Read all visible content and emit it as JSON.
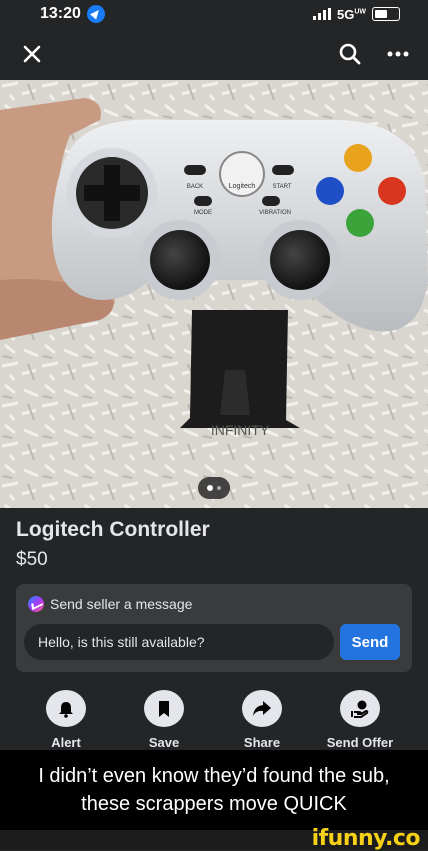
{
  "status_bar": {
    "time": "13:20",
    "network": "5G",
    "network_sup": "UW"
  },
  "nav": {
    "close_icon": "close-icon",
    "search_icon": "search-icon",
    "more_icon": "more-icon"
  },
  "listing": {
    "title": "Logitech Controller",
    "price": "$50",
    "photo_texts": {
      "back": "BACK",
      "start": "START",
      "mode": "MODE",
      "vibration": "VIBRATION",
      "brand": "Logitech",
      "mount": "INFINITY"
    }
  },
  "message": {
    "header": "Send seller a message",
    "input_value": "Hello, is this still available?",
    "send_label": "Send"
  },
  "actions": [
    {
      "label": "Alert",
      "icon": "bell-icon"
    },
    {
      "label": "Save",
      "icon": "bookmark-icon"
    },
    {
      "label": "Share",
      "icon": "share-icon"
    },
    {
      "label": "Send Offer",
      "icon": "offer-icon"
    }
  ],
  "caption": "I didn’t even know they’d found the sub, these scrappers move QUICK",
  "watermark": "ifunny.co",
  "colors": {
    "accent": "#2374e1",
    "background": "#242526",
    "card": "#3a3b3c",
    "watermark": "#f7d117"
  }
}
